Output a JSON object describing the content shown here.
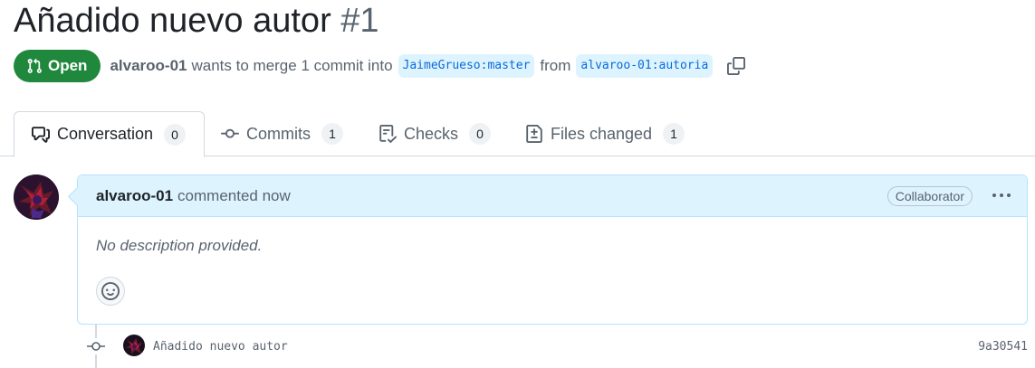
{
  "pull_request": {
    "title": "Añadido nuevo autor",
    "number": "#1",
    "state": "Open",
    "author": "alvaroo-01",
    "merge_text_1": "wants to merge 1 commit into",
    "base_branch": "JaimeGrueso:master",
    "merge_text_2": "from",
    "head_branch": "alvaroo-01:autoria"
  },
  "tabs": [
    {
      "label": "Conversation",
      "count": "0",
      "icon": "comment-discussion-icon"
    },
    {
      "label": "Commits",
      "count": "1",
      "icon": "git-commit-icon"
    },
    {
      "label": "Checks",
      "count": "0",
      "icon": "checklist-icon"
    },
    {
      "label": "Files changed",
      "count": "1",
      "icon": "file-diff-icon"
    }
  ],
  "comment": {
    "author": "alvaroo-01",
    "action": "commented now",
    "role": "Collaborator",
    "body": "No description provided."
  },
  "commit": {
    "message": "Añadido nuevo autor",
    "sha": "9a30541"
  },
  "colors": {
    "open_green": "#1f883d",
    "link_blue": "#0969da",
    "header_blue": "#ddf4ff"
  }
}
